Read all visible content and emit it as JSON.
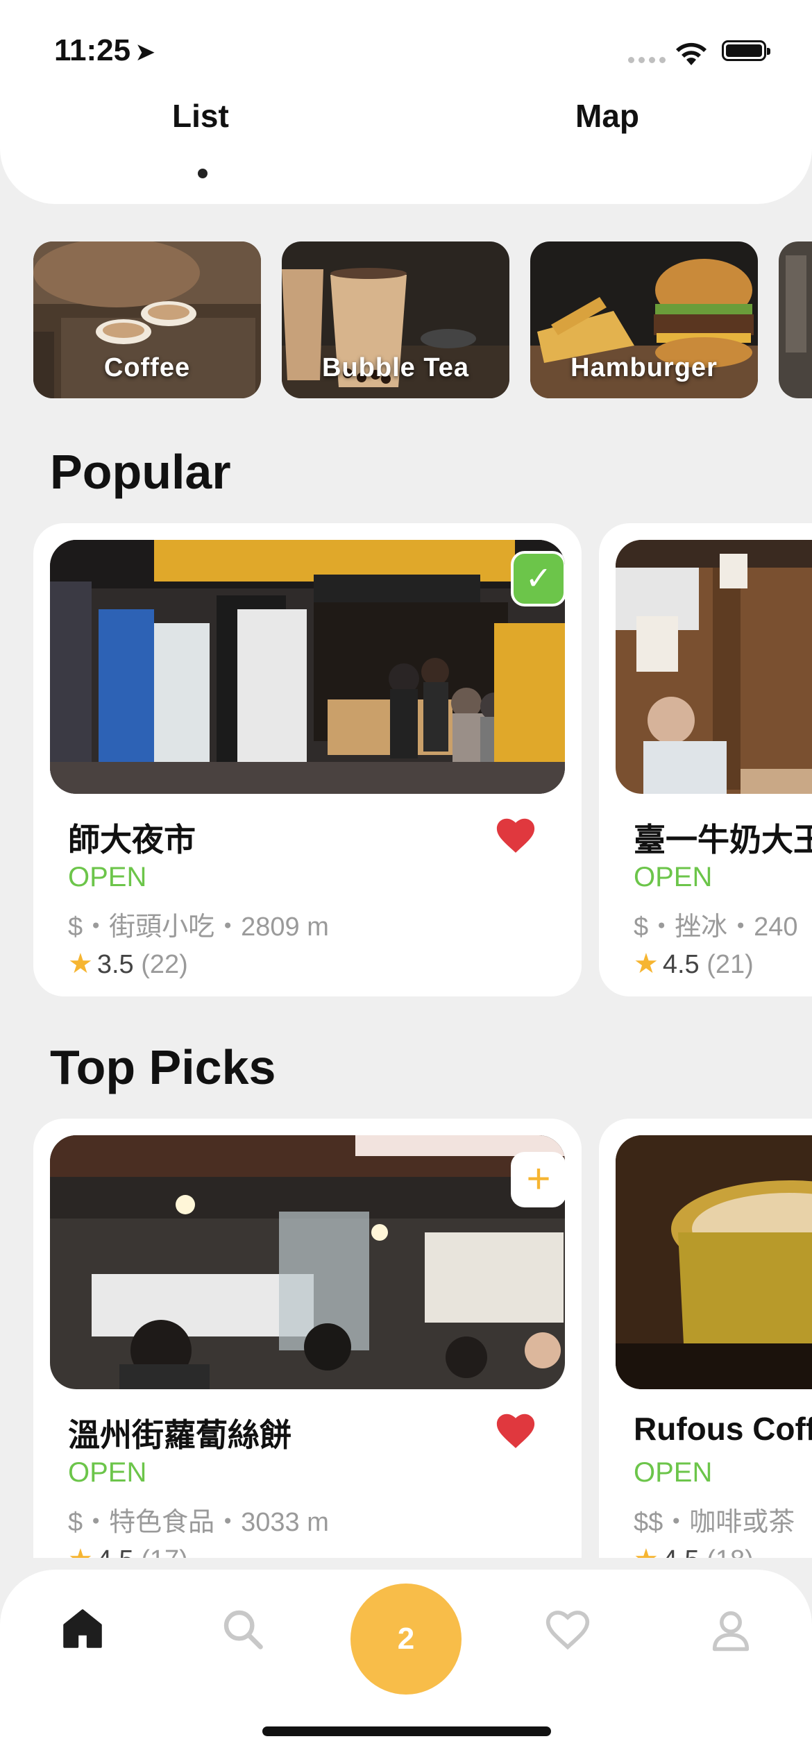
{
  "status_bar": {
    "time": "11:25"
  },
  "tabs": [
    {
      "label": "List",
      "active": true
    },
    {
      "label": "Map",
      "active": false
    }
  ],
  "categories": [
    {
      "label": "Coffee"
    },
    {
      "label": "Bubble Tea"
    },
    {
      "label": "Hamburger"
    },
    {
      "label": ""
    }
  ],
  "sections": {
    "popular": {
      "title": "Popular",
      "cards": [
        {
          "name": "師大夜市",
          "status": "OPEN",
          "meta": "$・街頭小吃・2809 m",
          "rating": "3.5",
          "count": "(22)",
          "badge": "check-icon",
          "favorited": true
        },
        {
          "name": "臺一牛奶大王",
          "status": "OPEN",
          "meta": "$・挫冰・240",
          "rating": "4.5",
          "count": "(21)",
          "badge": "",
          "favorited": false
        }
      ]
    },
    "top_picks": {
      "title": "Top Picks",
      "cards": [
        {
          "name": "溫州街蘿蔔絲餅",
          "status": "OPEN",
          "meta": "$・特色食品・3033 m",
          "rating": "4.5",
          "count": "(17)",
          "badge": "plus-icon",
          "favorited": true
        },
        {
          "name": "Rufous Coff",
          "status": "OPEN",
          "meta": "$$・咖啡或茶",
          "rating": "4.5",
          "count": "(18)",
          "badge": "",
          "favorited": false
        }
      ]
    }
  },
  "bottom_nav": {
    "items": [
      {
        "icon": "home-icon",
        "active": true
      },
      {
        "icon": "search-icon",
        "active": false
      },
      {
        "icon": "cart-count",
        "active": false
      },
      {
        "icon": "heart-icon",
        "active": false
      },
      {
        "icon": "profile-icon",
        "active": false
      }
    ],
    "center_count": "2"
  },
  "colors": {
    "accent": "#f8bd49",
    "open": "#6cc54a",
    "heart": "#e0383e",
    "star": "#f6b531"
  }
}
